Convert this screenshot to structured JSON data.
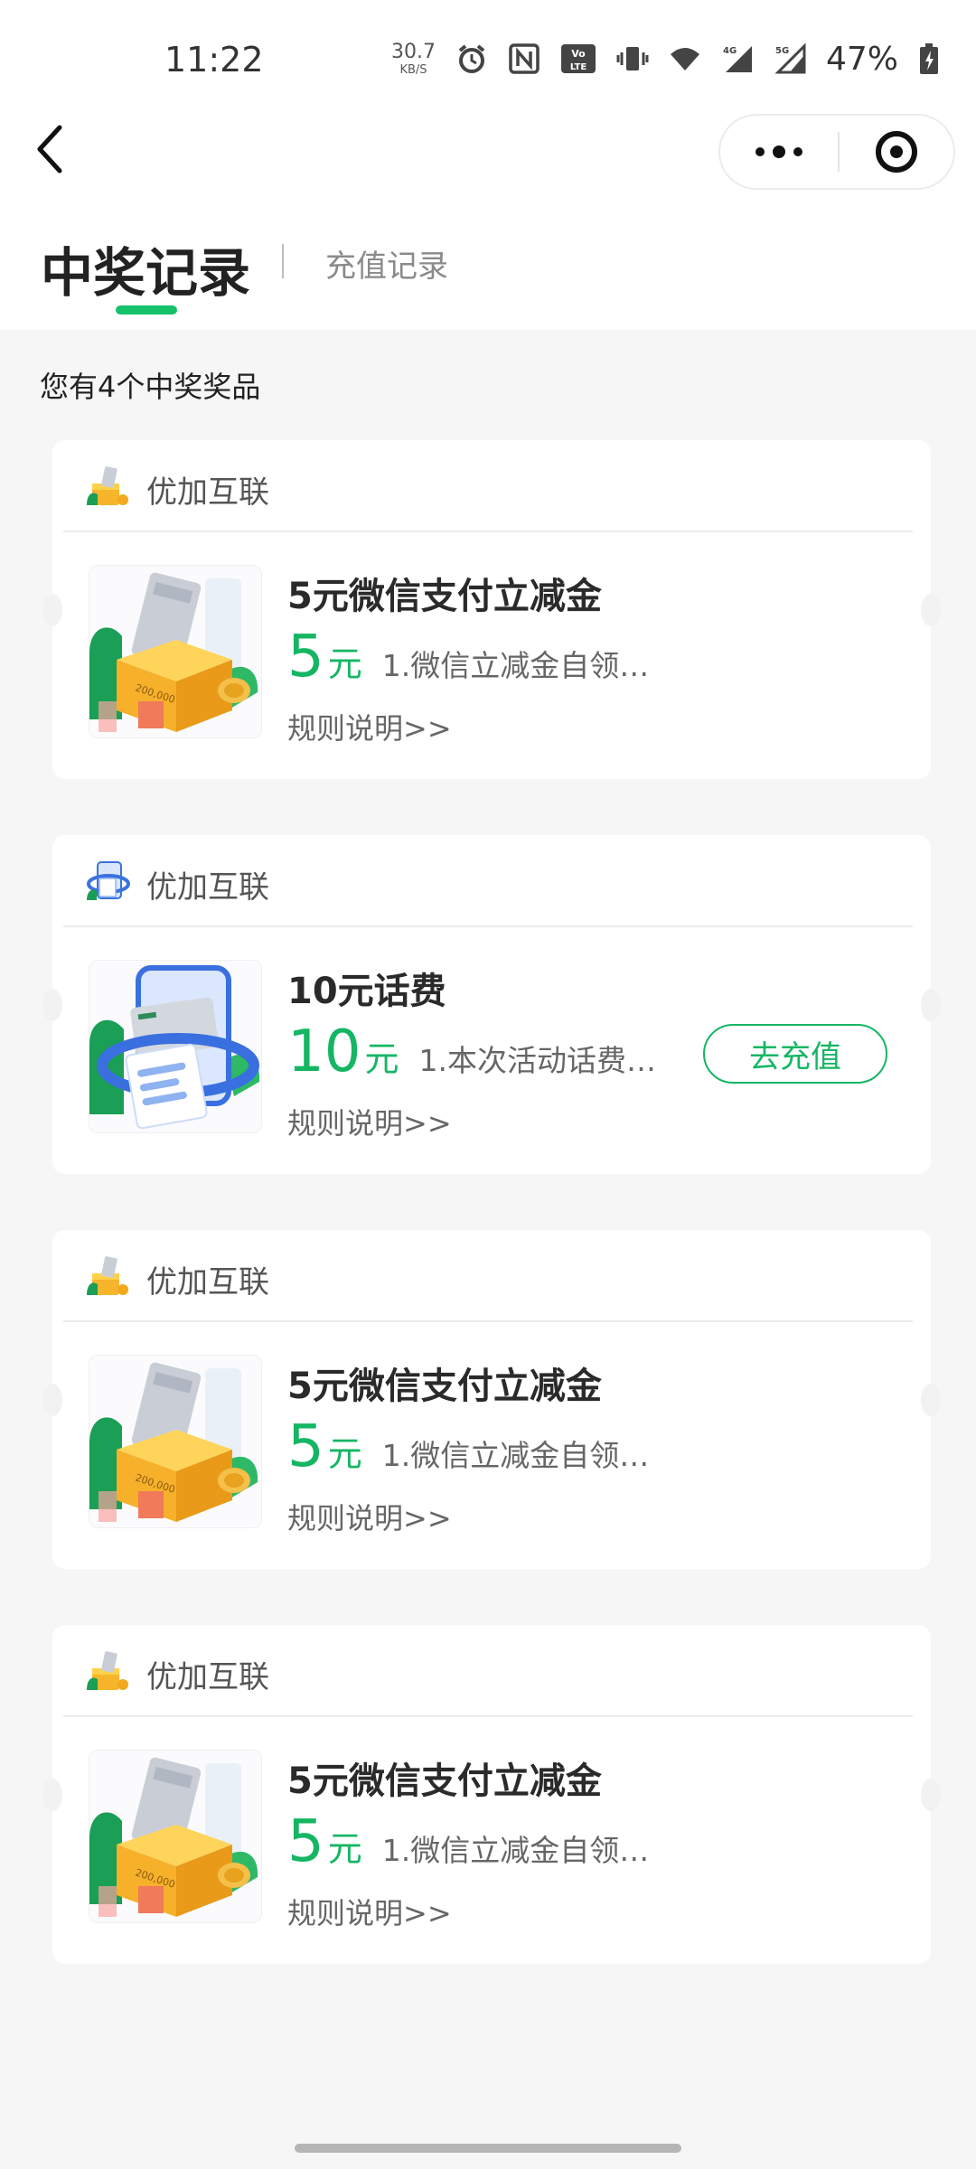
{
  "status_bar": {
    "time": "11:22",
    "net_speed_value": "30.7",
    "net_speed_unit": "KB/S",
    "battery": "47%"
  },
  "tabs": {
    "active": "中奖记录",
    "inactive": "充值记录"
  },
  "summary": "您有4个中奖奖品",
  "prizes": [
    {
      "merchant": "优加互联",
      "title": "5元微信支付立减金",
      "amount": "5",
      "unit": "元",
      "desc": "1.微信立减金自领…",
      "rules": "规则说明>>",
      "image": "gift-box",
      "action": ""
    },
    {
      "merchant": "优加互联",
      "title": "10元话费",
      "amount": "10",
      "unit": "元",
      "desc": "1.本次活动话费…",
      "rules": "规则说明>>",
      "image": "phone-card",
      "action": "去充值"
    },
    {
      "merchant": "优加互联",
      "title": "5元微信支付立减金",
      "amount": "5",
      "unit": "元",
      "desc": "1.微信立减金自领…",
      "rules": "规则说明>>",
      "image": "gift-box",
      "action": ""
    },
    {
      "merchant": "优加互联",
      "title": "5元微信支付立减金",
      "amount": "5",
      "unit": "元",
      "desc": "1.微信立减金自领…",
      "rules": "规则说明>>",
      "image": "gift-box",
      "action": ""
    }
  ],
  "colors": {
    "accent": "#15b663",
    "tab_underline": "#15c26a",
    "background": "#f6f6f6"
  }
}
